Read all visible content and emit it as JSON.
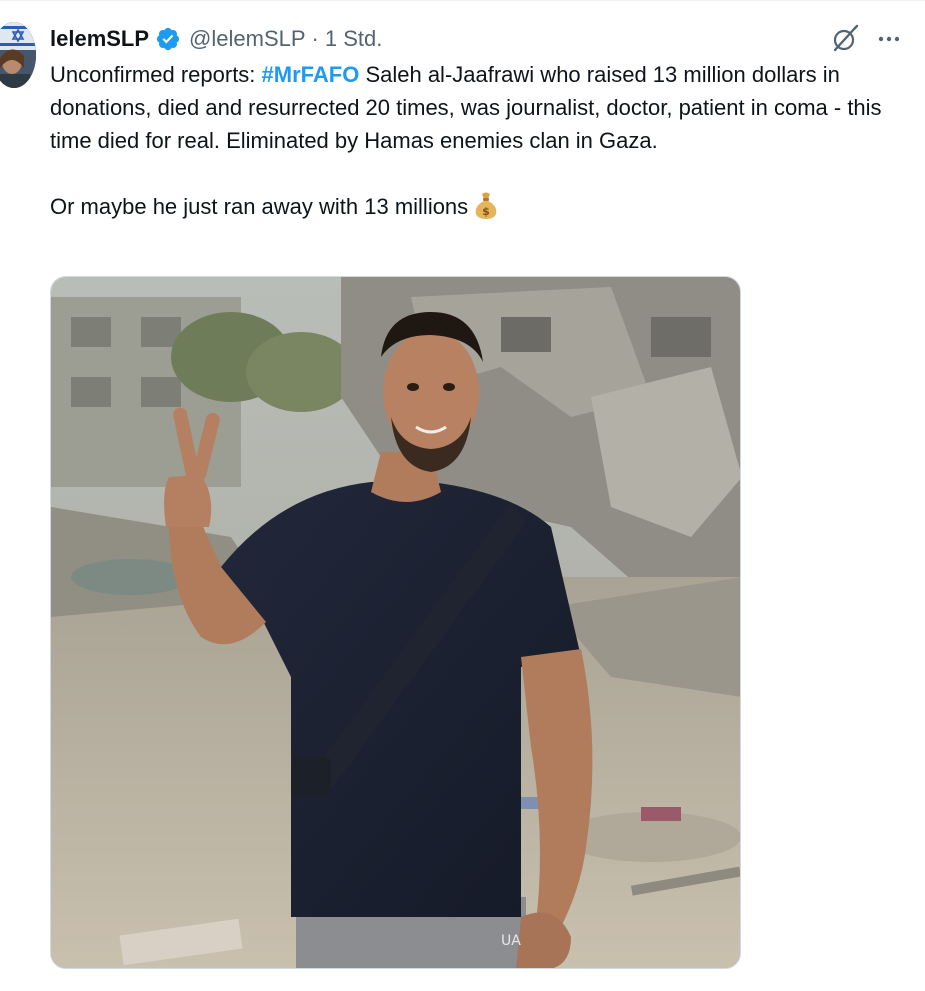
{
  "tweet": {
    "author": {
      "display_name": "lelemSLP",
      "handle": "@lelemSLP",
      "verified": true
    },
    "separator": "·",
    "timestamp": "1 Std.",
    "text_line1_prefix": "Unconfirmed reports: ",
    "hashtag": "#MrFAFO",
    "text_line1_rest": " Saleh al-Jaafrawi who raised 13 million dollars in donations, died and resurrected 20 times, was journalist, doctor, patient in coma - this time died for real. Eliminated by Hamas enemies clan in Gaza.",
    "text_line2": "Or maybe he just ran away with 13 millions",
    "emoji": "money-bag-icon"
  },
  "colors": {
    "accent": "#1d9bf0",
    "text": "#0f1419",
    "secondary": "#536471"
  }
}
